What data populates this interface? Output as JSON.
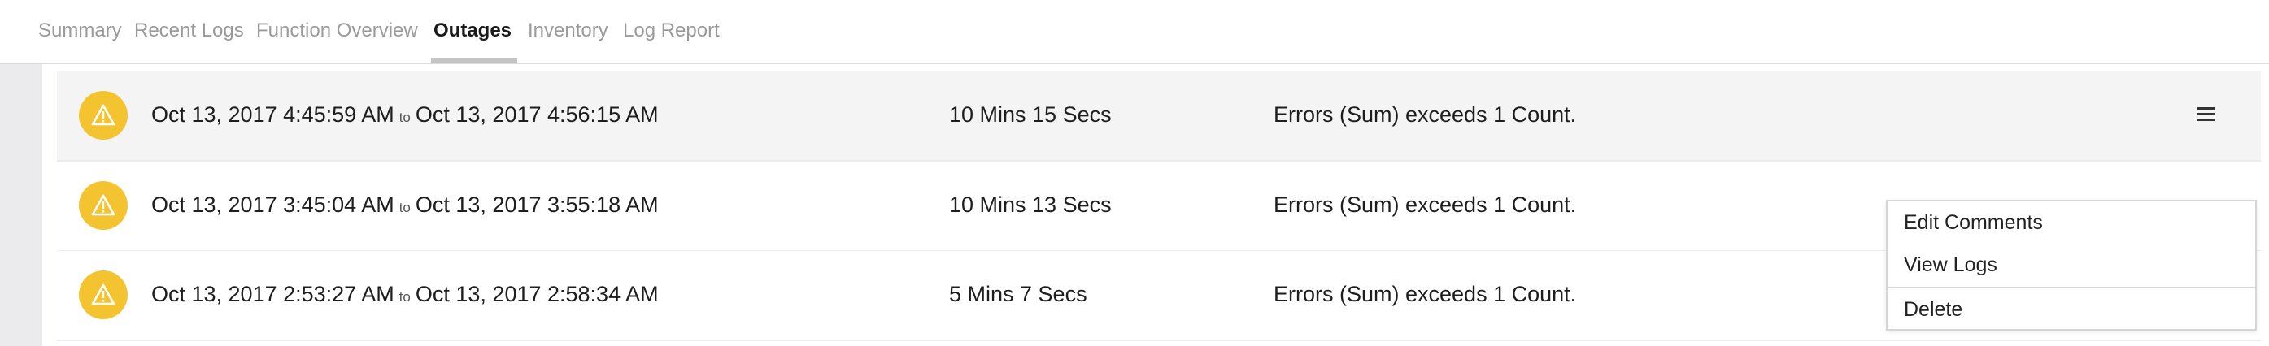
{
  "tabs": [
    {
      "label": "Summary"
    },
    {
      "label": "Recent Logs"
    },
    {
      "label": "Function Overview"
    },
    {
      "label": "Outages"
    },
    {
      "label": "Inventory"
    },
    {
      "label": "Log Report"
    }
  ],
  "active_tab": "Outages",
  "outages": [
    {
      "start": "Oct 13, 2017 4:45:59 AM",
      "to": "to",
      "end": "Oct 13, 2017 4:56:15 AM",
      "duration": "10 Mins 15 Secs",
      "reason": "Errors (Sum) exceeds 1 Count."
    },
    {
      "start": "Oct 13, 2017 3:45:04 AM",
      "to": "to",
      "end": "Oct 13, 2017 3:55:18 AM",
      "duration": "10 Mins 13 Secs",
      "reason": "Errors (Sum) exceeds 1 Count."
    },
    {
      "start": "Oct 13, 2017 2:53:27 AM",
      "to": "to",
      "end": "Oct 13, 2017 2:58:34 AM",
      "duration": "5 Mins 7 Secs",
      "reason": "Errors (Sum) exceeds 1 Count."
    }
  ],
  "row_menu": {
    "items": [
      {
        "label": "Edit Comments"
      },
      {
        "label": "View Logs"
      },
      {
        "label": "Delete"
      }
    ]
  },
  "icons": {
    "row_status": "warning-icon",
    "row_actions": "hamburger-menu-icon"
  },
  "colors": {
    "warning": "#f4c430",
    "active_tab_underline": "#c4c4c4",
    "highlight_row": "#f4f4f4"
  }
}
